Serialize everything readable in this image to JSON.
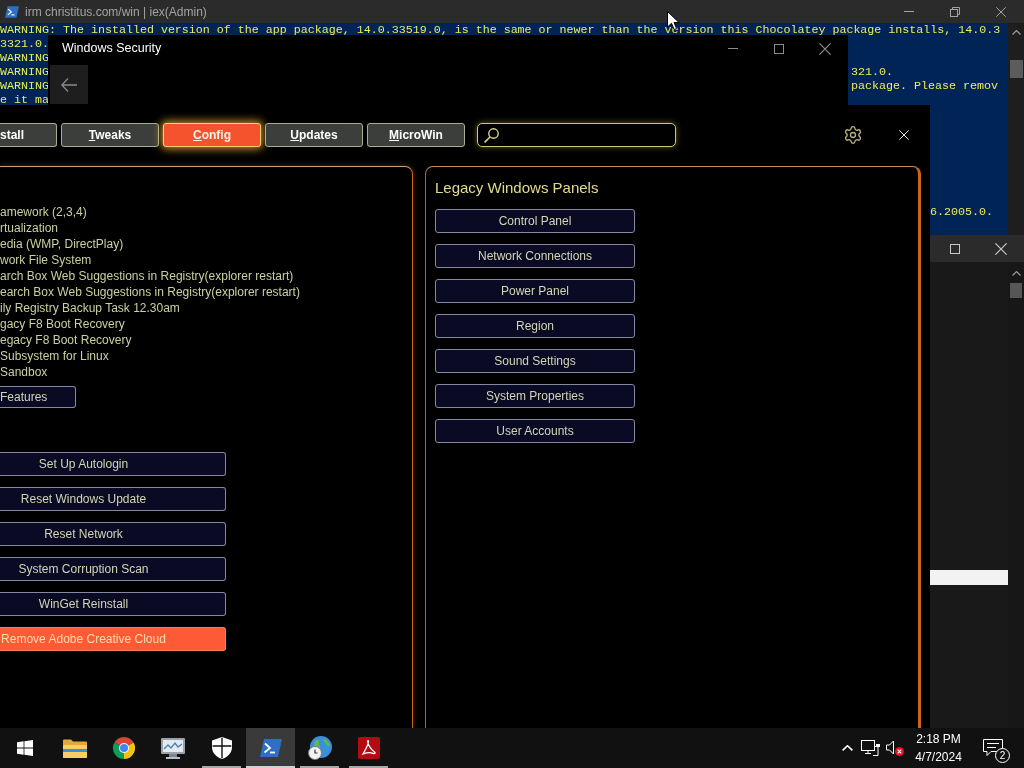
{
  "powershell_window": {
    "title": "irm christitus.com/win | iex(Admin)",
    "console_lines": [
      {
        "text": "WARNING: The installed version of the app package, 14.0.33519.0, is the same or newer than the version this Chocolatey package installs, 14.0.3"
      },
      {
        "text": "3321.0."
      },
      {
        "text": "WARNING"
      },
      {
        "text": "WARNING",
        "tail": "321.0."
      },
      {
        "text": "WARNING",
        "tail": "package. Please remov"
      },
      {
        "text": "e it ma"
      }
    ],
    "side_text": "6.2005.0."
  },
  "security_window": {
    "title": "Windows Security"
  },
  "winutil": {
    "tabs": [
      {
        "label": "stall",
        "selected": false,
        "underlined_initial": false
      },
      {
        "label": "Tweaks",
        "selected": false,
        "underlined_initial": true
      },
      {
        "label": "Config",
        "selected": true,
        "underlined_initial": true
      },
      {
        "label": "Updates",
        "selected": false,
        "underlined_initial": true
      },
      {
        "label": "MicroWin",
        "selected": false,
        "underlined_initial": true
      }
    ],
    "features": [
      "amework (2,3,4)",
      "rtualization",
      "edia (WMP, DirectPlay)",
      "work File System",
      "arch Box Web Suggestions in Registry(explorer restart)",
      "earch Box Web Suggestions in Registry(explorer restart)",
      "ily Registry Backup Task 12.30am",
      "gacy F8 Boot Recovery",
      "egacy F8 Boot Recovery",
      "Subsystem for Linux",
      "Sandbox"
    ],
    "features_button": "Features",
    "fix_buttons": [
      {
        "label": "Set Up Autologin",
        "highlighted": false
      },
      {
        "label": "Reset Windows Update",
        "highlighted": false
      },
      {
        "label": "Reset Network",
        "highlighted": false
      },
      {
        "label": "System Corruption Scan",
        "highlighted": false
      },
      {
        "label": "WinGet Reinstall",
        "highlighted": false
      },
      {
        "label": "Remove Adobe Creative Cloud",
        "highlighted": true
      }
    ],
    "legacy_panels": {
      "title": "Legacy Windows Panels",
      "buttons": [
        "Control Panel",
        "Network Connections",
        "Power Panel",
        "Region",
        "Sound Settings",
        "System Properties",
        "User Accounts"
      ]
    }
  },
  "taskbar": {
    "apps": [
      {
        "kind": "folder",
        "running": false,
        "active": false
      },
      {
        "kind": "browser",
        "running": false,
        "active": false
      },
      {
        "kind": "monitor",
        "running": false,
        "active": false
      },
      {
        "kind": "shield",
        "running": true,
        "active": false
      },
      {
        "kind": "terminal",
        "running": true,
        "active": true
      },
      {
        "kind": "globe",
        "running": true,
        "active": false
      },
      {
        "kind": "logo-tile",
        "running": true,
        "active": false
      }
    ],
    "time": "2:18 PM",
    "date": "4/7/2024",
    "notification_count": "2"
  }
}
